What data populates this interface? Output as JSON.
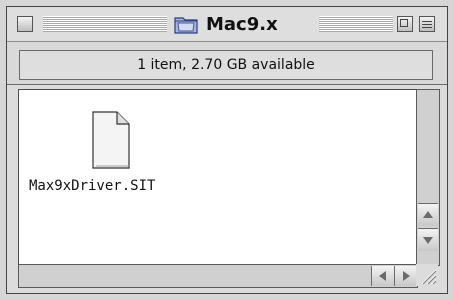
{
  "window": {
    "title": "Mac9.x",
    "title_icon": "folder-icon",
    "controls": {
      "close": "close-box",
      "zoom": "zoom-box",
      "collapse": "collapse-box"
    }
  },
  "header": {
    "status": "1 item, 2.70 GB available"
  },
  "content": {
    "items": [
      {
        "name": "Max9xDriver.SIT",
        "icon": "document-icon"
      }
    ]
  },
  "scrollbars": {
    "vertical": {
      "up": "up-arrow-icon",
      "down": "down-arrow-icon"
    },
    "horizontal": {
      "left": "left-arrow-icon",
      "right": "right-arrow-icon"
    },
    "grow": "grow-box-icon"
  }
}
